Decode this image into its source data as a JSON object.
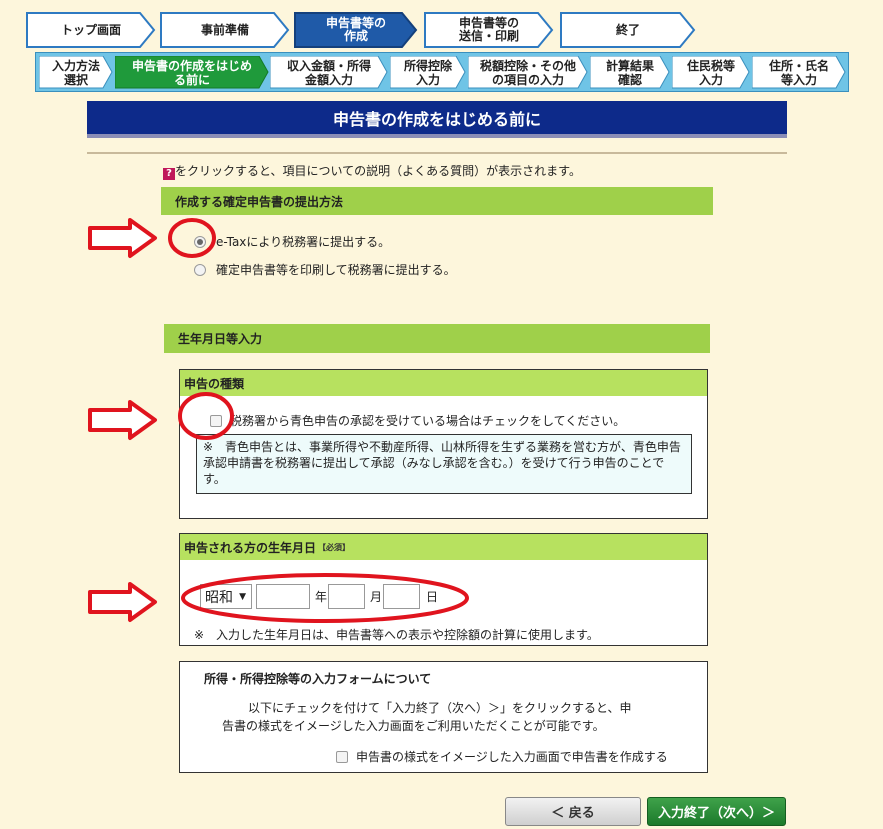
{
  "steps_top": [
    "トップ画面",
    "事前準備",
    "申告書等の\n作成",
    "申告書等の\n送信・印刷",
    "終了"
  ],
  "steps_sub": [
    "入力方法\n選択",
    "申告書の作成をはじめ\nる前に",
    "収入金額・所得\n金額入力",
    "所得控除\n入力",
    "税額控除・その他\nの項目の入力",
    "計算結果\n確認",
    "住民税等\n入力",
    "住所・氏名\n等入力"
  ],
  "header": {
    "title": "申告書の作成をはじめる前に"
  },
  "help": {
    "icon": "?",
    "text": "をクリックすると、項目についての説明（よくある質問）が表示されます。"
  },
  "filing": {
    "title": "作成する確定申告書の提出方法",
    "option1": "e-Taxにより税務署に提出する。",
    "option2": "確定申告書等を印刷して税務署に提出する。",
    "selected": "option1"
  },
  "birth_section": {
    "title": "生年月日等入力"
  },
  "kind": {
    "title": "申告の種類",
    "checkbox_label": "税務署から青色申告の承認を受けている場合はチェックをしてください。",
    "note": "※　青色申告とは、事業所得や不動産所得、山林所得を生ずる業務を営む方が、青色申告承認申請書を税務署に提出して承認（みなし承認を含む。）を受けて行う申告のことです。"
  },
  "birthdate": {
    "title": "申告される方の生年月日",
    "required": "【必須】",
    "era": "昭和",
    "year_unit": "年",
    "month_unit": "月",
    "day_unit": "日",
    "note": "※　入力した生年月日は、申告書等への表示や控除額の計算に使用します。"
  },
  "form_info": {
    "title": "所得・所得控除等の入力フォームについて",
    "text1": "以下にチェックを付けて「入力終了（次へ）＞」をクリックすると、申",
    "text2": "告書の様式をイメージした入力画面をご利用いただくことが可能です。",
    "checkbox_label": "申告書の様式をイメージした入力画面で申告書を作成する"
  },
  "buttons": {
    "back": "＜ 戻る",
    "next": "入力終了（次へ）＞"
  },
  "colors": {
    "header": "#0d2a8a",
    "section": "#9fd04a",
    "active_step": "#1f5aa8",
    "annotation": "#e0141e"
  }
}
